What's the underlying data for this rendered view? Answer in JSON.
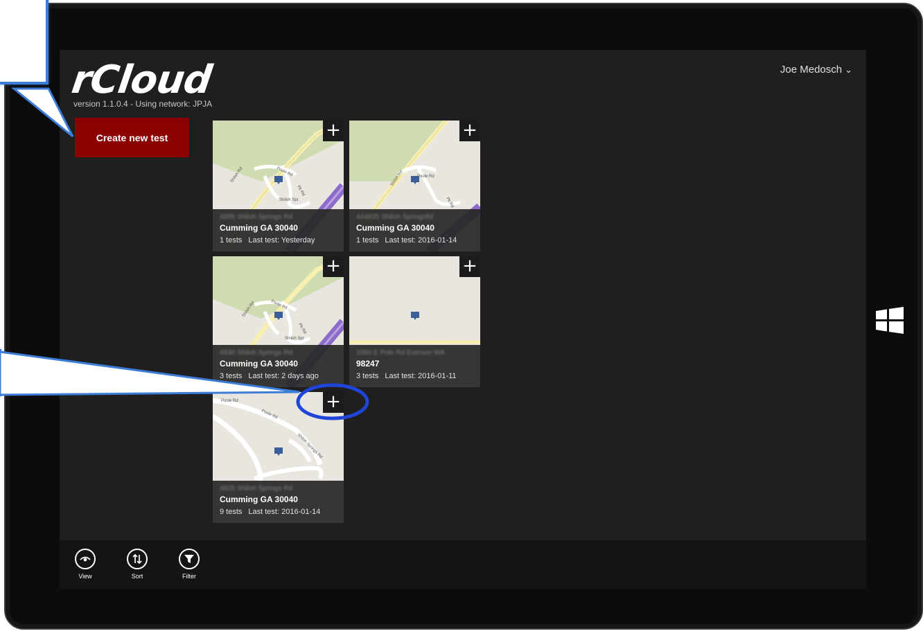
{
  "app": {
    "logo": "rCloud",
    "version": "version 1.1.0.4 - Using network: JPJA",
    "user": "Joe Medosch"
  },
  "actions": {
    "create_new_test": "Create new test"
  },
  "add_label": "+",
  "sites": [
    {
      "street": "4955 Shiloh Springs Rd",
      "city": "Cumming GA 30040",
      "tests": "1 tests",
      "last_test": "Last test:  Yesterday"
    },
    {
      "street": "444935 Shiloh Springsfld",
      "city": "Cumming  GA 30040",
      "tests": "1 tests",
      "last_test": "Last test:  2016-01-14"
    },
    {
      "street": "4930 Shiloh Springs Rd",
      "city": "Cumming GA 30040",
      "tests": "3 tests",
      "last_test": "Last test:  2 days ago"
    },
    {
      "street": "1060 E Pole Rd Everson WA",
      "city": "98247",
      "tests": "3 tests",
      "last_test": "Last test:  2016-01-11"
    },
    {
      "street": "4925 Shiloh Springs Rd",
      "city": "Cumming GA 30040",
      "tests": "9 tests",
      "last_test": "Last test:  2016-01-14"
    }
  ],
  "map_labels": {
    "shiloh_rd": "Shiloh Rd",
    "poole_rd": "Poole Rd",
    "pk_rd": "Pk Rd",
    "shiloh_springs": "Shiloh Spr",
    "shiloh_springs_rd": "Shiloh Springs Rd"
  },
  "appbar": {
    "view": "View",
    "sort": "Sort",
    "filter": "Filter"
  },
  "colors": {
    "accent_button": "#8b0000",
    "callout_border": "#3c7dd9",
    "screen_background": "#1f1f1f",
    "map_park": "#cfdcb1",
    "map_highway": "#8d6bc9",
    "map_pin": "#3d5f99"
  }
}
